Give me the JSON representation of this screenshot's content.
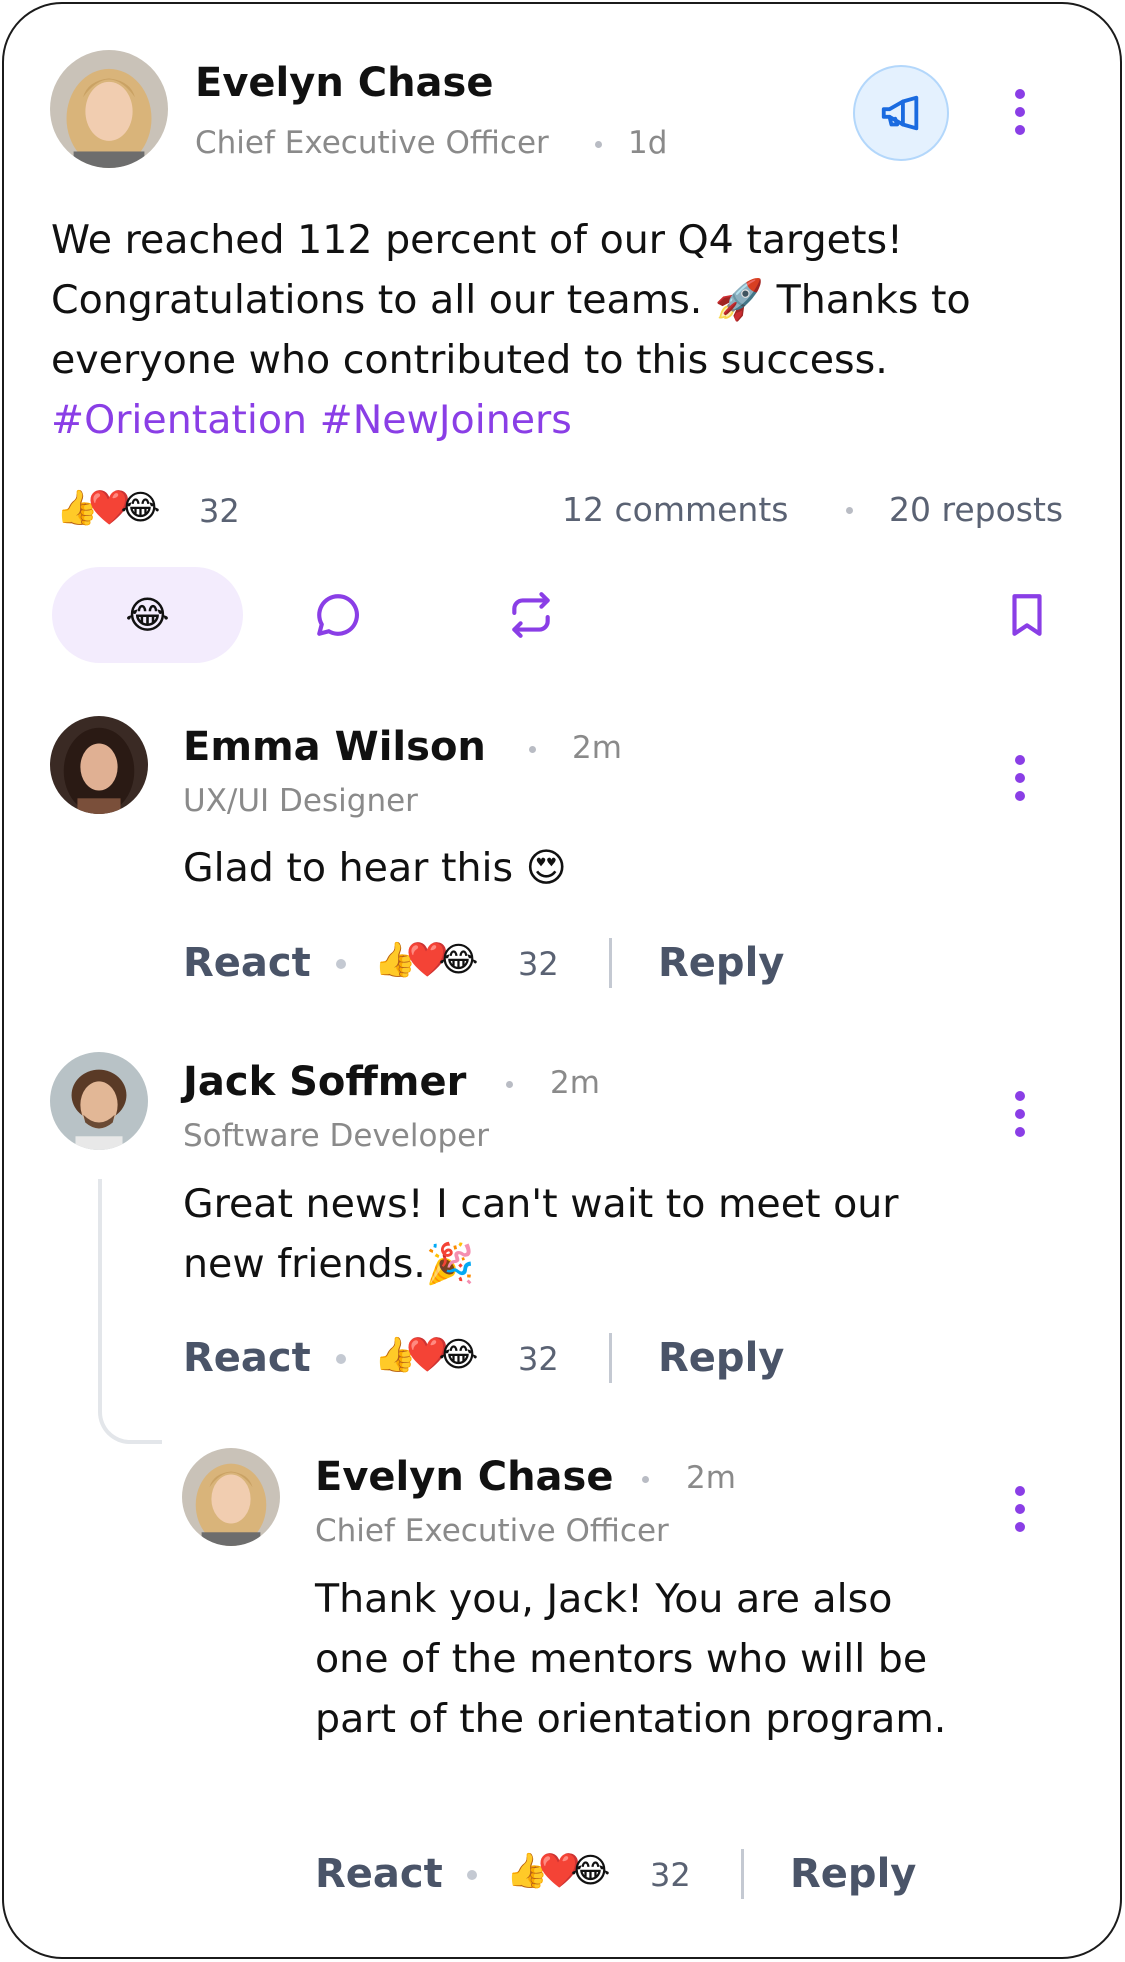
{
  "post": {
    "author": {
      "name": "Evelyn Chase",
      "role": "Chief Executive Officer",
      "time": "1d"
    },
    "text": "We reached 112 percent of our Q4 targets! Congratulations to all our teams. 🚀 Thanks to everyone who contributed to this success.",
    "hashtags": "#Orientation #NewJoiners",
    "reactions": {
      "emojis": "👍❤️😂",
      "count": "32"
    },
    "comments_count": "12 comments",
    "reposts_count": "20 reposts",
    "actions": {
      "react_emoji": "😂",
      "comment_icon": "comment-icon",
      "repost_icon": "repost-icon",
      "bookmark_icon": "bookmark-icon"
    },
    "announce_icon": "megaphone-icon",
    "accent_color": "#8a3ee6"
  },
  "comments": [
    {
      "name": "Emma Wilson",
      "role": "UX/UI Designer",
      "time": "2m",
      "text": "Glad to hear this 😍",
      "react_label": "React",
      "reply_label": "Reply",
      "reactions": {
        "emojis": "👍❤️😂",
        "count": "32"
      }
    },
    {
      "name": "Jack Soffmer",
      "role": "Software Developer",
      "time": "2m",
      "text": "Great news! I can't wait to meet our new friends.🎉",
      "react_label": "React",
      "reply_label": "Reply",
      "reactions": {
        "emojis": "👍❤️😂",
        "count": "32"
      }
    },
    {
      "name": "Evelyn Chase",
      "role": "Chief Executive Officer",
      "time": "2m",
      "text": "Thank you, Jack! You are also one of the mentors who will be part of the orientation program.",
      "react_label": "React",
      "reply_label": "Reply",
      "reactions": {
        "emojis": "👍❤️😂",
        "count": "32"
      }
    }
  ]
}
